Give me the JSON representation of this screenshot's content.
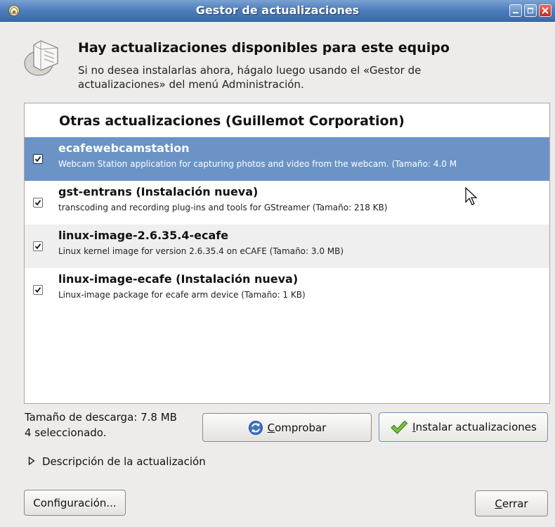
{
  "window": {
    "title": "Gestor de actualizaciones",
    "icon": "software-updater-icon"
  },
  "header": {
    "icon": "package-updates-icon",
    "title": "Hay actualizaciones disponibles para este equipo",
    "description": "Si no desea instalarlas ahora, hágalo luego usando el «Gestor de actualizaciones» del menú Administración."
  },
  "list": {
    "group_header": "Otras actualizaciones (Guillemot Corporation)",
    "items": [
      {
        "name": "ecafewebcamstation",
        "description": "Webcam Station application for capturing photos and video from the webcam. (Tamaño: 4.0 M",
        "checked": true,
        "selected": true
      },
      {
        "name": "gst-entrans (Instalación nueva)",
        "description": "transcoding and recording plug-ins and tools for GStreamer (Tamaño: 218 KB)",
        "checked": true,
        "selected": false
      },
      {
        "name": "linux-image-2.6.35.4-ecafe",
        "description": "Linux kernel image for version 2.6.35.4 on eCAFE (Tamaño: 3.0 MB)",
        "checked": true,
        "selected": false
      },
      {
        "name": "linux-image-ecafe (Instalación nueva)",
        "description": "Linux-image package for ecafe arm device (Tamaño: 1 KB)",
        "checked": true,
        "selected": false
      }
    ]
  },
  "status": {
    "download_size": "Tamaño de descarga: 7.8 MB",
    "selected_count": "4 seleccionado."
  },
  "buttons": {
    "check_first": "C",
    "check_rest": "omprobar",
    "check_icon": "refresh-icon",
    "install_first": "I",
    "install_rest": "nstalar actualizaciones",
    "install_icon": "checkmark-icon",
    "configuration": "Configuración...",
    "close_first": "C",
    "close_rest": "errar"
  },
  "expander": {
    "label": "Descripción de la actualización",
    "expanded": false
  },
  "colors": {
    "titlebar": "#4f7fbd",
    "selection": "#6b93c6",
    "window_bg": "#edeceb"
  }
}
